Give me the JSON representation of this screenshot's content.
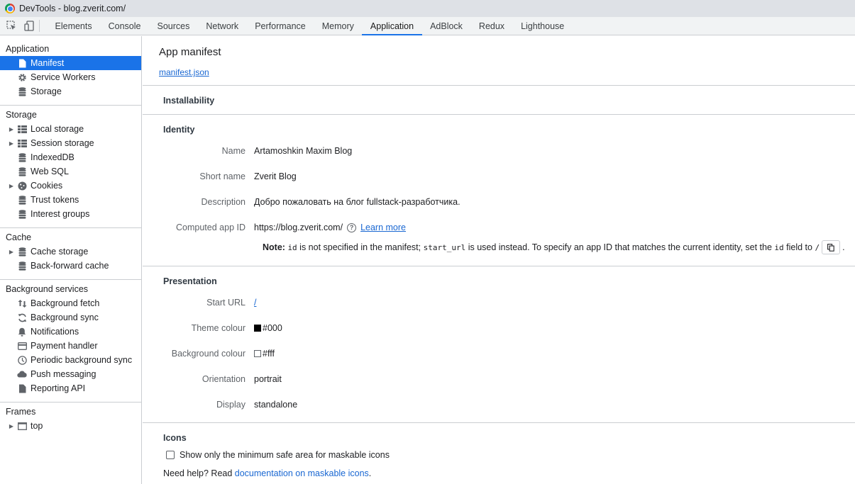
{
  "window": {
    "title": "DevTools - blog.zverit.com/"
  },
  "tabs": [
    {
      "label": "Elements"
    },
    {
      "label": "Console"
    },
    {
      "label": "Sources"
    },
    {
      "label": "Network"
    },
    {
      "label": "Performance"
    },
    {
      "label": "Memory"
    },
    {
      "label": "Application"
    },
    {
      "label": "AdBlock"
    },
    {
      "label": "Redux"
    },
    {
      "label": "Lighthouse"
    }
  ],
  "active_tab": "Application",
  "sidebar": {
    "application": {
      "title": "Application",
      "items": [
        {
          "label": "Manifest",
          "icon": "file-icon"
        },
        {
          "label": "Service Workers",
          "icon": "gear-icon"
        },
        {
          "label": "Storage",
          "icon": "database-icon"
        }
      ]
    },
    "storage": {
      "title": "Storage",
      "items": [
        {
          "label": "Local storage",
          "icon": "grid-icon"
        },
        {
          "label": "Session storage",
          "icon": "grid-icon"
        },
        {
          "label": "IndexedDB",
          "icon": "database-icon"
        },
        {
          "label": "Web SQL",
          "icon": "database-icon"
        },
        {
          "label": "Cookies",
          "icon": "cookie-icon"
        },
        {
          "label": "Trust tokens",
          "icon": "database-icon"
        },
        {
          "label": "Interest groups",
          "icon": "database-icon"
        }
      ]
    },
    "cache": {
      "title": "Cache",
      "items": [
        {
          "label": "Cache storage",
          "icon": "database-icon"
        },
        {
          "label": "Back-forward cache",
          "icon": "database-icon"
        }
      ]
    },
    "background": {
      "title": "Background services",
      "items": [
        {
          "label": "Background fetch",
          "icon": "arrows-updown-icon"
        },
        {
          "label": "Background sync",
          "icon": "sync-icon"
        },
        {
          "label": "Notifications",
          "icon": "bell-icon"
        },
        {
          "label": "Payment handler",
          "icon": "card-icon"
        },
        {
          "label": "Periodic background sync",
          "icon": "clock-icon"
        },
        {
          "label": "Push messaging",
          "icon": "cloud-icon"
        },
        {
          "label": "Reporting API",
          "icon": "file-icon"
        }
      ]
    },
    "frames": {
      "title": "Frames",
      "items": [
        {
          "label": "top",
          "icon": "window-icon"
        }
      ]
    }
  },
  "main": {
    "title": "App manifest",
    "manifest_link": "manifest.json",
    "installability": {
      "title": "Installability"
    },
    "identity": {
      "title": "Identity",
      "name_label": "Name",
      "name_value": "Artamoshkin Maxim Blog",
      "short_name_label": "Short name",
      "short_name_value": "Zverit Blog",
      "description_label": "Description",
      "description_value": "Добро пожаловать на блог fullstack-разработчика.",
      "computed_id_label": "Computed app ID",
      "computed_id_value": "https://blog.zverit.com/",
      "learn_more": "Learn more",
      "note_label": "Note:",
      "note_code1": "id",
      "note_text1": "is not specified in the manifest;",
      "note_code2": "start_url",
      "note_text2": "is used instead. To specify an app ID that matches the current identity, set the",
      "note_code3": "id",
      "note_text3": "field to",
      "note_code4": "/",
      "note_end": "."
    },
    "presentation": {
      "title": "Presentation",
      "start_url_label": "Start URL",
      "start_url_value": "/",
      "theme_label": "Theme colour",
      "theme_value": "#000",
      "theme_color": "#000000",
      "bg_label": "Background colour",
      "bg_value": "#fff",
      "bg_color": "#ffffff",
      "orientation_label": "Orientation",
      "orientation_value": "portrait",
      "display_label": "Display",
      "display_value": "standalone"
    },
    "icons": {
      "title": "Icons",
      "checkbox_label": "Show only the minimum safe area for maskable icons",
      "help_prefix": "Need help? Read",
      "help_link": "documentation on maskable icons",
      "help_suffix": "."
    }
  },
  "colors": {
    "accent": "#1a73e8",
    "link": "#1967d2"
  }
}
